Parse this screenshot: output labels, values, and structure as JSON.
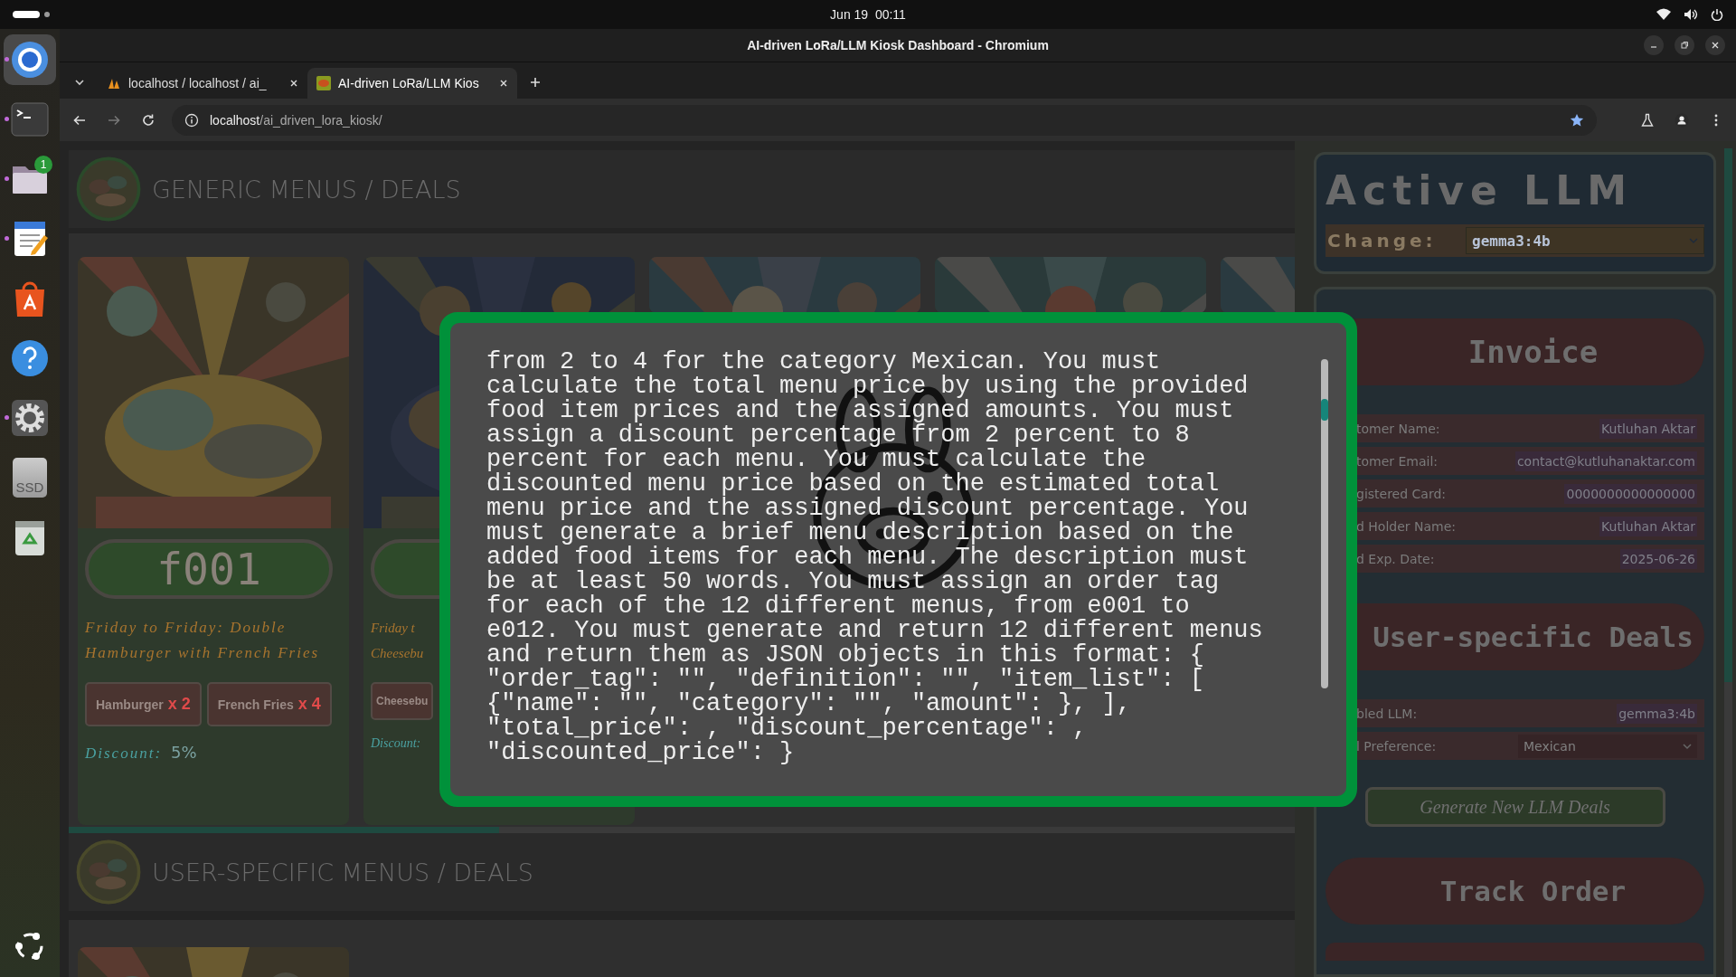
{
  "top_bar": {
    "datetime": "Jun 19  00:11"
  },
  "dock": {
    "items": [
      {
        "kind": "browser",
        "running": true,
        "active": true
      },
      {
        "kind": "terminal",
        "running": true,
        "active": false
      },
      {
        "kind": "files",
        "running": true,
        "active": false,
        "badge": "1"
      },
      {
        "kind": "editor",
        "running": true,
        "active": false
      },
      {
        "kind": "store",
        "running": false,
        "active": false
      },
      {
        "kind": "help",
        "running": false,
        "active": false
      },
      {
        "kind": "settings",
        "running": true,
        "active": false
      },
      {
        "kind": "drive",
        "running": false,
        "active": false,
        "label": "SSD"
      },
      {
        "kind": "trash",
        "running": false,
        "active": false
      }
    ]
  },
  "window": {
    "title": "AI-driven LoRa/LLM Kiosk Dashboard - Chromium"
  },
  "tabs": [
    {
      "label": "localhost / localhost / ai_",
      "selected": false
    },
    {
      "label": "AI-driven LoRa/LLM Kios",
      "selected": true
    }
  ],
  "address_bar": {
    "host": "localhost",
    "path": "/ai_driven_lora_kiosk/"
  },
  "generic_section": {
    "title": "GENERIC MENUS / DEALS",
    "cards": [
      {
        "tag": "f001",
        "title": "Friday to Friday: Double Hamburger with French Fries",
        "items": [
          {
            "name": "Hamburger",
            "amount": "x 2"
          },
          {
            "name": "French Fries",
            "amount": "x 4"
          }
        ],
        "discount_label": "Discount:",
        "discount": "5%"
      },
      {
        "title": "Friday t Cheesebu",
        "items": [
          {
            "name": "Cheesebu"
          }
        ],
        "discount_label": "Discount:"
      }
    ]
  },
  "user_section": {
    "title": "USER-SPECIFIC MENUS / DEALS"
  },
  "active_llm": {
    "title": "Active LLM",
    "change_label": "Change:",
    "model": "gemma3:4b"
  },
  "invoice": {
    "title": "Invoice",
    "rows": [
      {
        "label": "tomer Name:",
        "value": "Kutluhan Aktar"
      },
      {
        "label": "tomer Email:",
        "value": "contact@kutluhanaktar.com"
      },
      {
        "label": "gistered Card:",
        "value": "0000000000000000"
      },
      {
        "label": "d Holder Name:",
        "value": "Kutluhan Aktar"
      },
      {
        "label": "d Exp. Date:",
        "value": "2025-06-26"
      }
    ]
  },
  "user_deals": {
    "title": "User-specific Deals",
    "llm_label": "bled LLM:",
    "llm_value": "gemma3:4b",
    "preference_label": "l Preference:",
    "preference": "Mexican",
    "generate_button": "Generate New LLM Deals"
  },
  "track_order": {
    "title": "Track Order"
  },
  "modal": {
    "text": "from 2 to 4 for the category Mexican. You must calculate the total menu price by using the provided food item prices and the assigned amounts. You must assign a discount percentage from 2 percent to 8 percent for each menu. You must calculate the discounted menu price based on the estimated total menu price and the assigned discount percentage. You must generate a brief menu description based on the added food items for each menu. The description must be at least 50 words. You must assign an order tag for each of the 12 different menus, from e001 to e012. You must generate and return 12 different menus and return them as JSON objects in this format: { \"order_tag\": \"\", \"definition\": \"\", \"item_list\": [ {\"name\": \"\", \"category\": \"\", \"amount\": }, ], \"total_price\": , \"discount_percentage\": , \"discounted_price\": }"
  }
}
